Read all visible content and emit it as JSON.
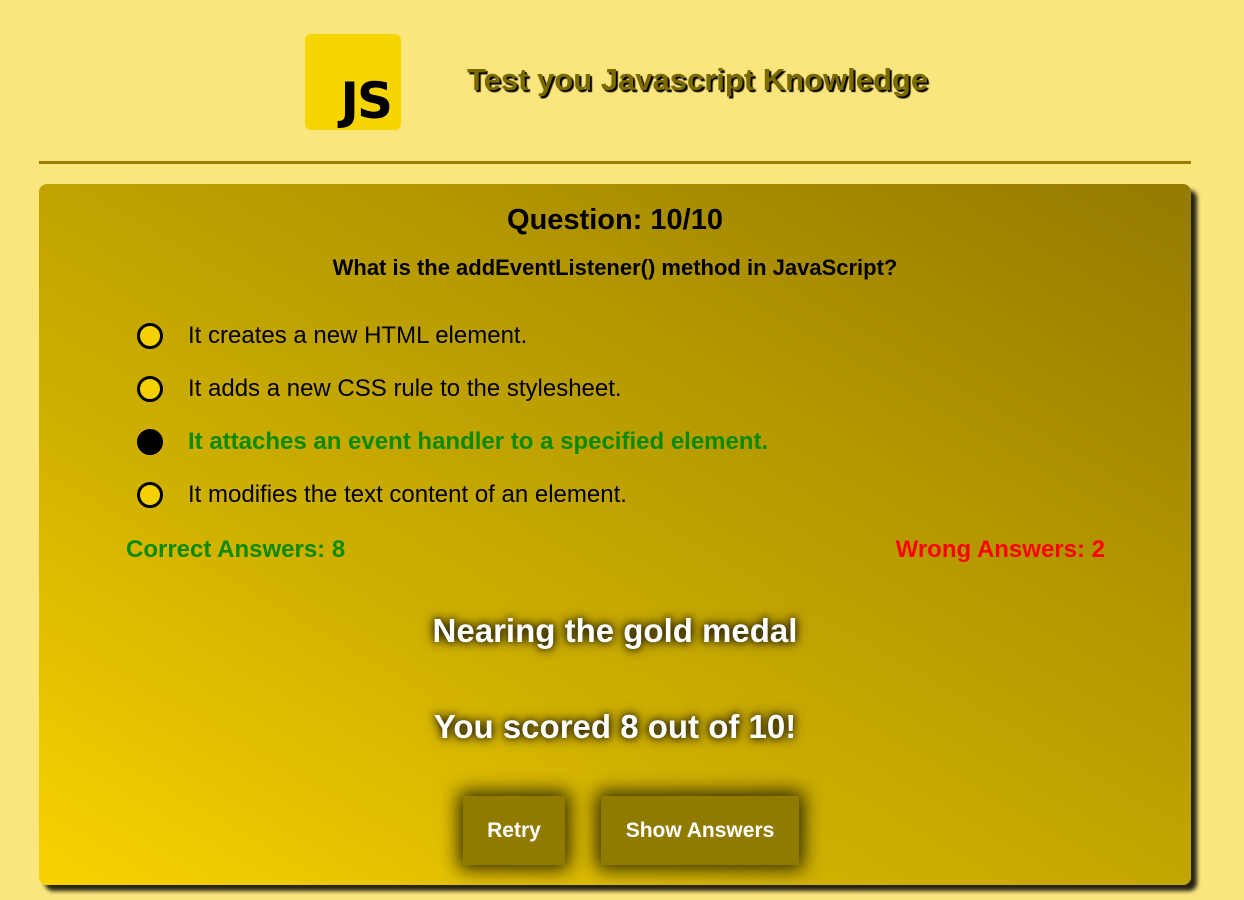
{
  "header": {
    "logo_text": "JS",
    "title": "Test you Javascript Knowledge"
  },
  "quiz": {
    "counter": "Question: 10/10",
    "question": "What is the addEventListener() method in JavaScript?",
    "options": [
      {
        "label": "It creates a new HTML element.",
        "selected": false,
        "correct": false
      },
      {
        "label": "It adds a new CSS rule to the stylesheet.",
        "selected": false,
        "correct": false
      },
      {
        "label": "It attaches an event handler to a specified element.",
        "selected": true,
        "correct": true
      },
      {
        "label": "It modifies the text content of an element.",
        "selected": false,
        "correct": false
      }
    ],
    "correct_answers": "Correct Answers: 8",
    "wrong_answers": "Wrong Answers: 2",
    "result_message": "Nearing the gold medal",
    "score_message": "You scored 8 out of 10!"
  },
  "buttons": {
    "retry": "Retry",
    "show_answers": "Show Answers"
  },
  "colors": {
    "background": "#fbe67e",
    "logo_bg": "#f7d600",
    "card_gradient_start": "#f8d300",
    "card_gradient_end": "#947a00",
    "correct": "#0a8a00",
    "wrong": "#ff0000",
    "button_bg": "#917a00"
  }
}
